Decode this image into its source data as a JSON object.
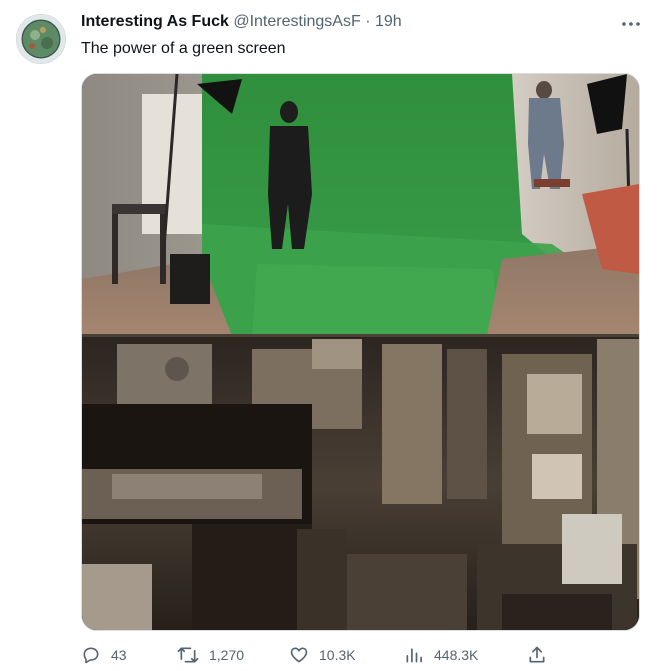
{
  "tweet": {
    "author_name": "Interesting As Fuck",
    "author_handle": "@InterestingsAsF",
    "separator": "·",
    "timestamp": "19h",
    "text": "The power of a green screen",
    "more_icon": "more-horizontal-icon",
    "media": {
      "kind": "video-gif",
      "top_panel": "green screen studio",
      "bottom_panel": "composited industrial room"
    }
  },
  "actions": {
    "replies": "43",
    "retweets": "1,270",
    "likes": "10.3K",
    "views": "448.3K",
    "icons": {
      "reply": "reply-icon",
      "retweet": "retweet-icon",
      "like": "heart-icon",
      "views": "views-chart-icon",
      "share": "share-icon"
    }
  },
  "colors": {
    "text": "#0f1419",
    "secondary": "#536471",
    "green_screen": "#3f9a4b"
  }
}
